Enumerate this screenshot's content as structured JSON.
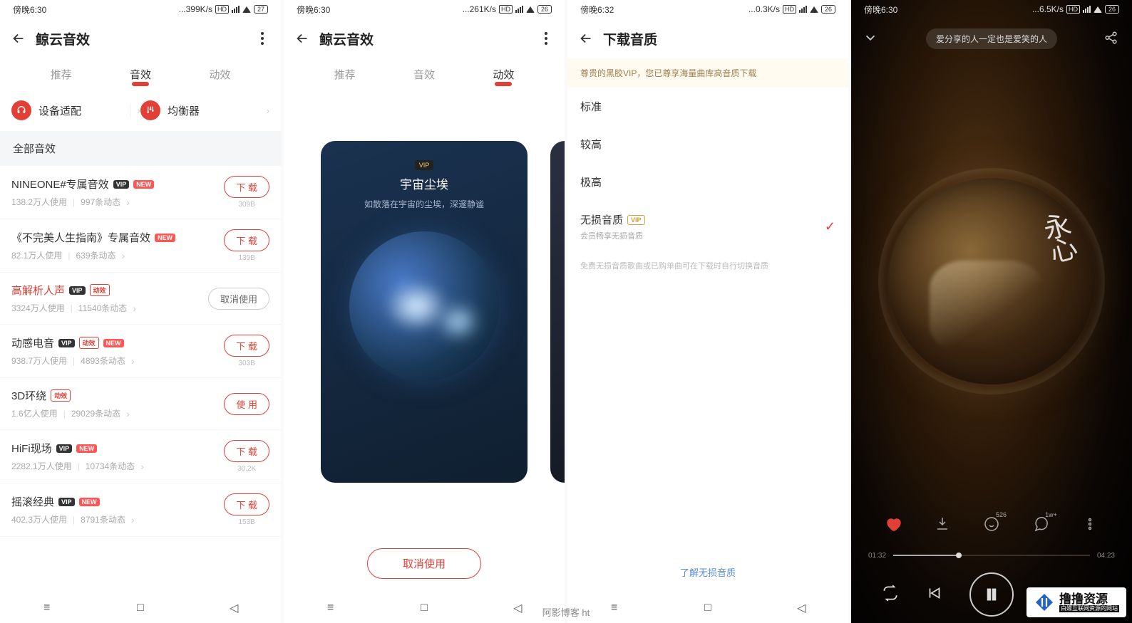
{
  "status": {
    "time1": "傍晚6:30",
    "time2": "傍晚6:30",
    "time3": "傍晚6:32",
    "time4": "傍晚6:30",
    "net1": "...399K/s",
    "net2": "...261K/s",
    "net3": "...0.3K/s",
    "net4": "...6.5K/s",
    "hd": "HD",
    "batt1": "27",
    "batt2": "26",
    "batt3": "26",
    "batt4": "26"
  },
  "p1": {
    "title": "鲸云音效",
    "tabs": {
      "t1": "推荐",
      "t2": "音效",
      "t3": "动效"
    },
    "tool1": "设备适配",
    "tool2": "均衡器",
    "section": "全部音效",
    "btn_dl": "下 载",
    "btn_use": "使 用",
    "btn_cancel": "取消使用",
    "items": [
      {
        "title": "NINEONE#专属音效",
        "vip": "VIP",
        "new": "NEW",
        "sub1": "138.2万人使用",
        "sub2": "997条动态",
        "size": "309B"
      },
      {
        "title": "《不完美人生指南》专属音效",
        "new": "NEW",
        "sub1": "82.1万人使用",
        "sub2": "639条动态",
        "size": "139B"
      },
      {
        "title": "高解析人声",
        "vip": "VIP",
        "dx": "动效",
        "sub1": "3324万人使用",
        "sub2": "11540条动态"
      },
      {
        "title": "动感电音",
        "vip": "VIP",
        "dx": "动效",
        "new": "NEW",
        "sub1": "938.7万人使用",
        "sub2": "4893条动态",
        "size": "303B"
      },
      {
        "title": "3D环绕",
        "dx": "动效",
        "sub1": "1.6亿人使用",
        "sub2": "29029条动态"
      },
      {
        "title": "HiFi现场",
        "vip": "VIP",
        "new": "NEW",
        "sub1": "2282.1万人使用",
        "sub2": "10734条动态",
        "size": "30.2K"
      },
      {
        "title": "摇滚经典",
        "vip": "VIP",
        "new": "NEW",
        "sub1": "402.3万人使用",
        "sub2": "8791条动态",
        "size": "153B"
      }
    ]
  },
  "p2": {
    "title": "鲸云音效",
    "tabs": {
      "t1": "推荐",
      "t2": "音效",
      "t3": "动效"
    },
    "card": {
      "vip": "VIP",
      "title": "宇宙尘埃",
      "sub": "如散落在宇宙的尘埃，深邃静谧"
    },
    "btn": "取消使用"
  },
  "p3": {
    "title": "下载音质",
    "notice": "尊贵的黑胶VIP，您已尊享海量曲库高音质下载",
    "opts": {
      "o1": "标准",
      "o2": "较高",
      "o3": "极高",
      "o4": "无损音质",
      "o4vip": "VIP",
      "o4sub": "会员畅享无损音质"
    },
    "foot": "免费无损音质歌曲或已购单曲可在下载时自行切换音质",
    "link": "了解无损音质"
  },
  "p4": {
    "pill": "爱分享的人一定也是爱笑的人",
    "like_count": "",
    "sing_count": "526",
    "comment_count": "1w+",
    "time_cur": "01:32",
    "time_total": "04:23"
  },
  "watermark": {
    "t1": "撸撸资源",
    "t2": "白嫖互联网资源的网站"
  },
  "footer_note": "阿影博客 ht"
}
